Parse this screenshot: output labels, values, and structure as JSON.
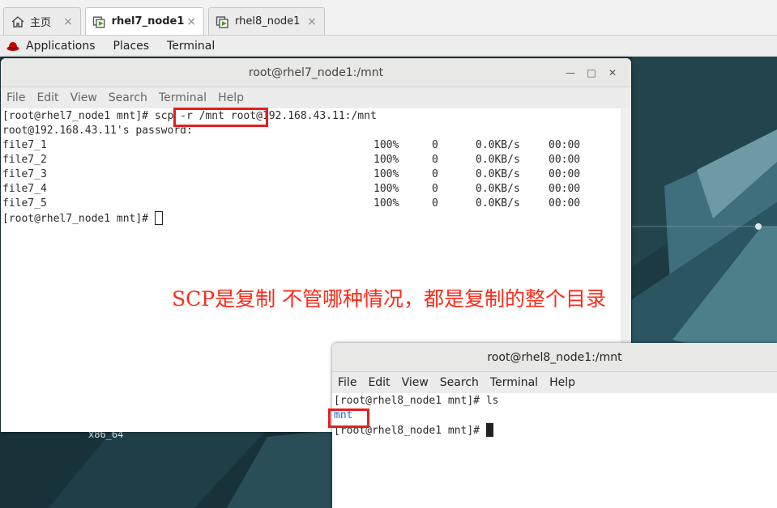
{
  "tabs": [
    {
      "label": "主页",
      "icon": "home-icon"
    },
    {
      "label": "rhel7_node1",
      "icon": "vm-icon"
    },
    {
      "label": "rhel8_node1",
      "icon": "vm-icon"
    }
  ],
  "tab_close_glyph": "×",
  "panel": {
    "applications": "Applications",
    "places": "Places",
    "terminal": "Terminal"
  },
  "desktop": {
    "arch_label": "x86_64"
  },
  "window1": {
    "title": "root@rhel7_node1:/mnt",
    "menu": [
      "File",
      "Edit",
      "View",
      "Search",
      "Terminal",
      "Help"
    ],
    "lines": {
      "cmd_prompt": "[root@rhel7_node1 mnt]# ",
      "cmd": "scp -r /mnt",
      "cmd_rest": " root@192.168.43.11:/mnt",
      "password": "root@192.168.43.11's password:",
      "end_prompt": "[root@rhel7_node1 mnt]# "
    },
    "transfers": [
      {
        "file": "file7_1",
        "percent": "100%",
        "size": "0",
        "speed": "0.0KB/s",
        "time": "00:00"
      },
      {
        "file": "file7_2",
        "percent": "100%",
        "size": "0",
        "speed": "0.0KB/s",
        "time": "00:00"
      },
      {
        "file": "file7_3",
        "percent": "100%",
        "size": "0",
        "speed": "0.0KB/s",
        "time": "00:00"
      },
      {
        "file": "file7_4",
        "percent": "100%",
        "size": "0",
        "speed": "0.0KB/s",
        "time": "00:00"
      },
      {
        "file": "file7_5",
        "percent": "100%",
        "size": "0",
        "speed": "0.0KB/s",
        "time": "00:00"
      }
    ]
  },
  "window2": {
    "title": "root@rhel8_node1:/mnt",
    "menu": [
      "File",
      "Edit",
      "View",
      "Search",
      "Terminal",
      "Help"
    ],
    "lines": {
      "ls_cmd": "[root@rhel8_node1 mnt]# ls",
      "ls_result": "mnt",
      "end_prompt": "[root@rhel8_node1 mnt]# "
    }
  },
  "annotation": "SCP是复制 不管哪种情况，都是复制的整个目录",
  "colors": {
    "highlight": "#e02020",
    "annotation": "#ff2a1a",
    "dir_blue": "#1e6bd6"
  }
}
